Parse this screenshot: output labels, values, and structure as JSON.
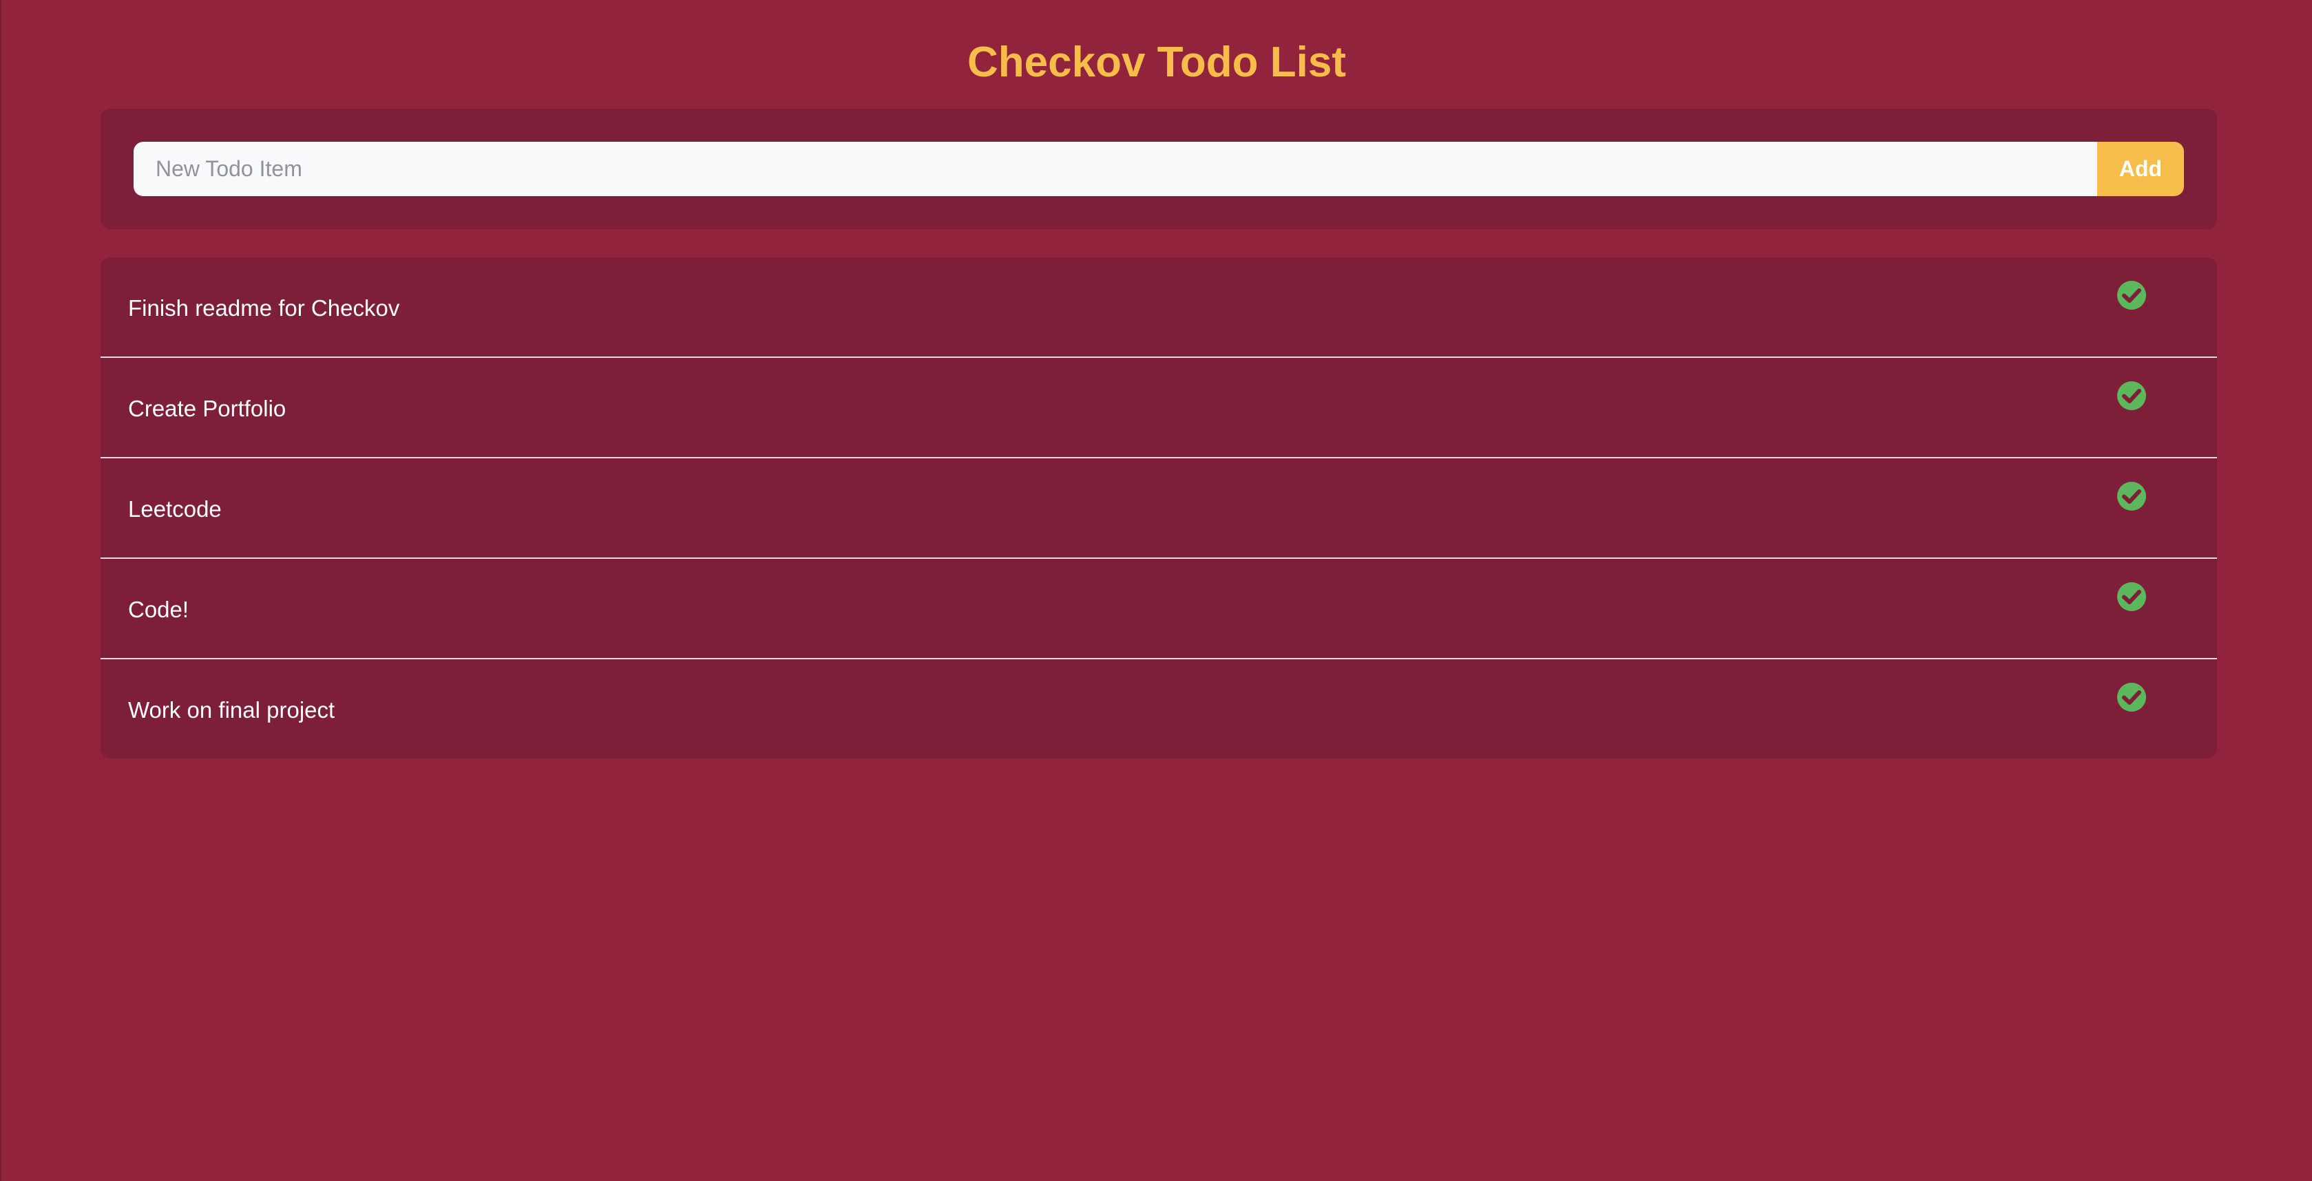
{
  "app": {
    "title": "Checkov Todo List"
  },
  "entry": {
    "input_value": "",
    "placeholder": "New Todo Item",
    "add_label": "Add"
  },
  "todos": [
    {
      "text": "Finish readme for Checkov",
      "icon": "check-circle-icon"
    },
    {
      "text": "Create Portfolio",
      "icon": "check-circle-icon"
    },
    {
      "text": "Leetcode",
      "icon": "check-circle-icon"
    },
    {
      "text": "Code!",
      "icon": "check-circle-icon"
    },
    {
      "text": "Work on final project",
      "icon": "check-circle-icon"
    }
  ],
  "colors": {
    "background": "#92233c",
    "panel": "#7d1f39",
    "accent": "#f6bd4a",
    "check": "#5cb85c",
    "text": "#ffffff"
  }
}
